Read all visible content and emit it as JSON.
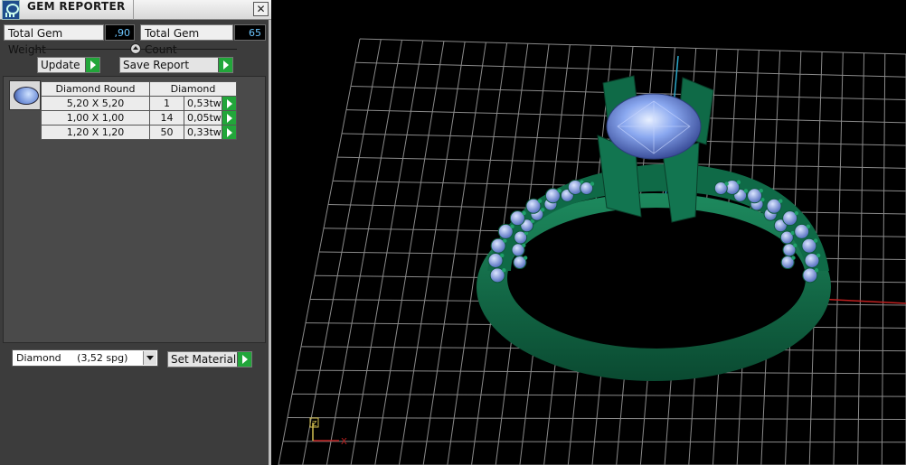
{
  "window": {
    "title": "GEM REPORTER",
    "close_glyph": "✕"
  },
  "stats": {
    "total_weight_label": "Total Gem Weight",
    "total_weight_value": ",90",
    "total_count_label": "Total Gem Count",
    "total_count_value": "65"
  },
  "actions": {
    "update_label": "Update",
    "save_label": "Save Report"
  },
  "table": {
    "headers": [
      "Diamond Round",
      "Diamond"
    ],
    "rows": [
      {
        "size": "5,20 X 5,20",
        "count": "1",
        "weight": "0,53tw"
      },
      {
        "size": "1,00 X 1,00",
        "count": "14",
        "weight": "0,05tw"
      },
      {
        "size": "1,20 X 1,20",
        "count": "50",
        "weight": "0,33tw"
      }
    ]
  },
  "material": {
    "selected": "Diamond     (3,52 spg)",
    "set_label": "Set Material"
  },
  "viewport": {
    "axis_x_label": "X",
    "axis_z_label": "Z"
  },
  "colors": {
    "panel_bg": "#3c3c3c",
    "accent_green": "#22a63a",
    "value_text": "#6cc6ff",
    "ring_metal": "#0f6a47",
    "gem_blue": "#8aa8f0",
    "grid": "#8a8a8a"
  },
  "icons": {
    "app": "gem-reporter-app-icon",
    "close": "close-icon",
    "collapse": "collapse-arrow-icon",
    "go": "green-play-arrow-icon",
    "gem": "round-diamond-icon",
    "dropdown": "chevron-down-icon"
  }
}
